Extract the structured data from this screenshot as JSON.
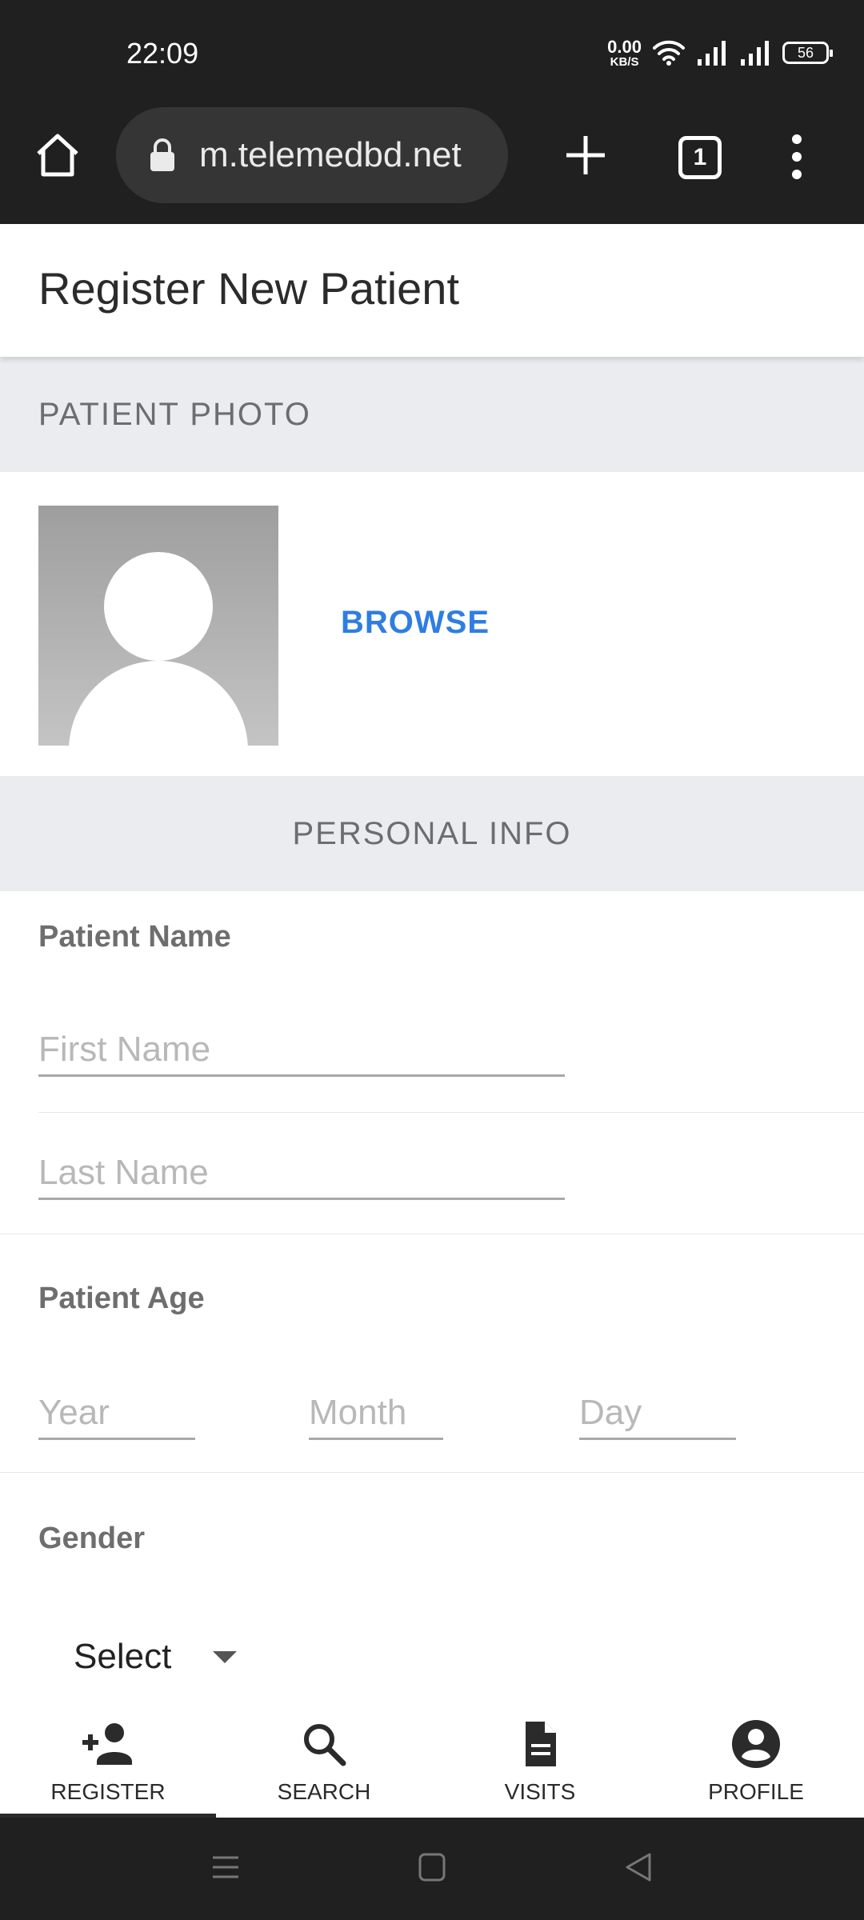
{
  "status_bar": {
    "time": "22:09",
    "net_speed_value": "0.00",
    "net_speed_unit": "KB/S",
    "battery": "56"
  },
  "browser": {
    "url": "m.telemedbd.net",
    "tab_count": "1"
  },
  "header": {
    "title": "Register New Patient"
  },
  "photo_section": {
    "title": "PATIENT PHOTO",
    "browse_label": "BROWSE"
  },
  "personal_info": {
    "title": "PERSONAL INFO",
    "name_label": "Patient Name",
    "first_name_placeholder": "First Name",
    "last_name_placeholder": "Last Name",
    "age_label": "Patient Age",
    "year_placeholder": "Year",
    "month_placeholder": "Month",
    "day_placeholder": "Day",
    "gender_label": "Gender",
    "gender_value": "Select"
  },
  "bottom_nav": {
    "items": [
      {
        "label": "REGISTER",
        "icon": "person-add-icon",
        "active": true
      },
      {
        "label": "SEARCH",
        "icon": "search-icon",
        "active": false
      },
      {
        "label": "VISITS",
        "icon": "document-icon",
        "active": false
      },
      {
        "label": "PROFILE",
        "icon": "account-circle-icon",
        "active": false
      }
    ]
  },
  "colors": {
    "accent": "#2f7de1",
    "section_bg": "#ebecef",
    "system_bar": "#202020"
  }
}
